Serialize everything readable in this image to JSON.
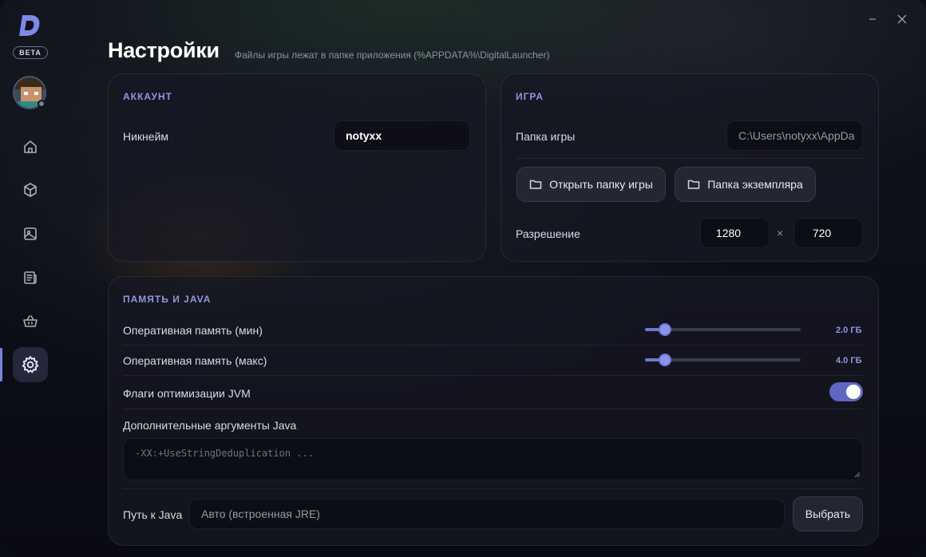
{
  "app": {
    "badge": "BETA"
  },
  "sidebar": {
    "items": [
      {
        "name": "home",
        "icon": "home-icon"
      },
      {
        "name": "instances",
        "icon": "cube-icon"
      },
      {
        "name": "gallery",
        "icon": "image-icon"
      },
      {
        "name": "news",
        "icon": "newspaper-icon"
      },
      {
        "name": "store",
        "icon": "basket-icon"
      },
      {
        "name": "settings",
        "icon": "gear-icon",
        "active": true
      }
    ]
  },
  "header": {
    "title": "Настройки",
    "subtitle": "Файлы игры лежат в папке приложения (%APPDATA%\\DigitalLauncher)"
  },
  "account": {
    "title": "АККАУНТ",
    "nickname_label": "Никнейм",
    "nickname_value": "notyxx"
  },
  "game": {
    "title": "ИГРА",
    "folder_label": "Папка игры",
    "folder_value": "C:\\Users\\notyxx\\AppDa",
    "open_folder_button": "Открыть папку игры",
    "instance_folder_button": "Папка экземпляра",
    "resolution_label": "Разрешение",
    "resolution_width": "1280",
    "resolution_separator": "×",
    "resolution_height": "720"
  },
  "memory": {
    "title": "ПАМЯТЬ И JAVA",
    "ram_min_label": "Оперативная память (мин)",
    "ram_min_value": "2.0 ГБ",
    "ram_min_fraction": 0.13,
    "ram_max_label": "Оперативная память (макс)",
    "ram_max_value": "4.0 ГБ",
    "ram_max_fraction": 0.13,
    "jvm_flags_label": "Флаги оптимизации JVM",
    "jvm_flags_enabled": true,
    "java_args_label": "Дополнительные аргументы Java",
    "java_args_placeholder": "-XX:+UseStringDeduplication ...",
    "java_path_label": "Путь к Java",
    "java_path_placeholder": "Авто (встроенная JRE)",
    "choose_button": "Выбрать"
  },
  "colors": {
    "accent": "#8f97e0",
    "toggle_on": "#5f67c4",
    "background": "#0c0e16"
  }
}
